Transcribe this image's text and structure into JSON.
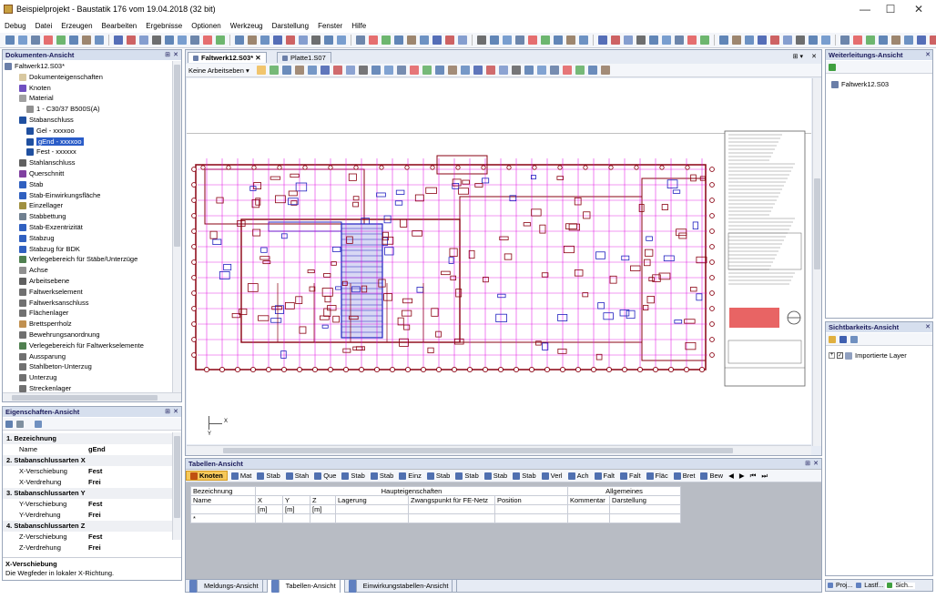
{
  "window": {
    "title": "Beispielprojekt - Baustatik 176 vom 19.04.2018 (32 bit)",
    "minimize": "—",
    "maximize": "☐",
    "close": "✕"
  },
  "menu": [
    "Debug",
    "Datei",
    "Erzeugen",
    "Bearbeiten",
    "Ergebnisse",
    "Optionen",
    "Werkzeug",
    "Darstellung",
    "Fenster",
    "Hilfe"
  ],
  "doc_view": {
    "title": "Dokumenten-Ansicht",
    "items": [
      {
        "label": "Faltwerk12.S03*",
        "indent": 0,
        "color": "#6a7ea8"
      },
      {
        "label": "Dokumenteigenschaften",
        "indent": 2,
        "color": "#d8c8a0"
      },
      {
        "label": "Knoten",
        "indent": 2,
        "color": "#7050c0"
      },
      {
        "label": "Material",
        "indent": 2,
        "color": "#a0a0a0"
      },
      {
        "label": "1 - C30/37 B500S(A)",
        "indent": 3,
        "color": "#909090"
      },
      {
        "label": "Stabanschluss",
        "indent": 2,
        "color": "#2050a0"
      },
      {
        "label": "Gel - xxxxoo",
        "indent": 3,
        "color": "#2050a0"
      },
      {
        "label": "gEnd - xxxxoo",
        "indent": 3,
        "color": "#2050a0",
        "selected": true
      },
      {
        "label": "Fest - xxxxxx",
        "indent": 3,
        "color": "#2050a0"
      },
      {
        "label": "Stahlanschluss",
        "indent": 2,
        "color": "#606060"
      },
      {
        "label": "Querschnitt",
        "indent": 2,
        "color": "#8040a0"
      },
      {
        "label": "Stab",
        "indent": 2,
        "color": "#3060c0"
      },
      {
        "label": "Stab-Einwirkungsfläche",
        "indent": 2,
        "color": "#3060c0"
      },
      {
        "label": "Einzellager",
        "indent": 2,
        "color": "#a09040"
      },
      {
        "label": "Stabbettung",
        "indent": 2,
        "color": "#708090"
      },
      {
        "label": "Stab-Exzentrizität",
        "indent": 2,
        "color": "#3060c0"
      },
      {
        "label": "Stabzug",
        "indent": 2,
        "color": "#3060c0"
      },
      {
        "label": "Stabzug für BDK",
        "indent": 2,
        "color": "#3060c0"
      },
      {
        "label": "Verlegebereich für Stäbe/Unterzüge",
        "indent": 2,
        "color": "#508050"
      },
      {
        "label": "Achse",
        "indent": 2,
        "color": "#909090"
      },
      {
        "label": "Arbeitsebene",
        "indent": 2,
        "color": "#606060"
      },
      {
        "label": "Faltwerkselement",
        "indent": 2,
        "color": "#707070"
      },
      {
        "label": "Faltwerksanschluss",
        "indent": 2,
        "color": "#707070"
      },
      {
        "label": "Flächenlager",
        "indent": 2,
        "color": "#707070"
      },
      {
        "label": "Brettsperrholz",
        "indent": 2,
        "color": "#c09050"
      },
      {
        "label": "Bewehrungsanordnung",
        "indent": 2,
        "color": "#707070"
      },
      {
        "label": "Verlegebereich für Faltwerkselemente",
        "indent": 2,
        "color": "#508050"
      },
      {
        "label": "Aussparung",
        "indent": 2,
        "color": "#707070"
      },
      {
        "label": "Stahlbeton-Unterzug",
        "indent": 2,
        "color": "#707070"
      },
      {
        "label": "Unterzug",
        "indent": 2,
        "color": "#707070"
      },
      {
        "label": "Streckenlager",
        "indent": 2,
        "color": "#707070"
      }
    ]
  },
  "props_view": {
    "title": "Eigenschaften-Ansicht",
    "groups": [
      {
        "label": "1. Bezeichnung",
        "rows": [
          {
            "k": "Name",
            "v": "gEnd"
          }
        ]
      },
      {
        "label": "2. Stabanschlussarten X",
        "rows": [
          {
            "k": "X-Verschiebung",
            "v": "Fest"
          },
          {
            "k": "X-Verdrehung",
            "v": "Frei"
          }
        ]
      },
      {
        "label": "3. Stabanschlussarten Y",
        "rows": [
          {
            "k": "Y-Verschiebung",
            "v": "Fest"
          },
          {
            "k": "Y-Verdrehung",
            "v": "Frei"
          }
        ]
      },
      {
        "label": "4. Stabanschlussarten Z",
        "rows": [
          {
            "k": "Z-Verschiebung",
            "v": "Fest"
          },
          {
            "k": "Z-Verdrehung",
            "v": "Frei"
          }
        ]
      }
    ],
    "help_title": "X-Verschiebung",
    "help_text": "Die Wegfeder in lokaler X-Richtung."
  },
  "doc_tabs": [
    "Faltwerk12.S03*",
    "Platte1.S07"
  ],
  "cad": {
    "layer_select": "Keine Arbeitseben",
    "axis_x": "X",
    "axis_y": "Y"
  },
  "tables_view": {
    "title": "Tabellen-Ansicht",
    "tabs": [
      "Knoten",
      "Mat",
      "Stab",
      "Stah",
      "Que",
      "Stab",
      "Stab",
      "Einz",
      "Stab",
      "Stab",
      "Stab",
      "Stab",
      "Verl",
      "Ach",
      "Falt",
      "Falt",
      "Fläc",
      "Bret",
      "Bew"
    ],
    "header1": {
      "bez": "Bezeichnung",
      "haupt": "Haupteigenschaften",
      "allg": "Allgemeines"
    },
    "header2": [
      "Name",
      "X",
      "Y",
      "Z",
      "Lagerung",
      "Zwangspunkt für FE-Netz",
      "Position",
      "Kommentar",
      "Darstellung"
    ],
    "units": [
      "",
      "[m]",
      "[m]",
      "[m]",
      "",
      "",
      "",
      "",
      ""
    ],
    "newrow": "*"
  },
  "bottom_tabs": [
    "Meldungs-Ansicht",
    "Tabellen-Ansicht",
    "Einwirkungstabellen-Ansicht"
  ],
  "fwd_view": {
    "title": "Weiterleitungs-Ansicht",
    "item": "Faltwerk12.S03"
  },
  "vis_view": {
    "title": "Sichtbarkeits-Ansicht",
    "item": "Importierte Layer"
  },
  "right_tabs": [
    "Proj...",
    "Lastf...",
    "Sich..."
  ],
  "colors": {
    "accent": "#d6dfee",
    "selection": "#2a5cc8",
    "plan_red": "#8a0010",
    "plan_magenta": "#e000e0",
    "plan_blue": "#2020c0"
  }
}
